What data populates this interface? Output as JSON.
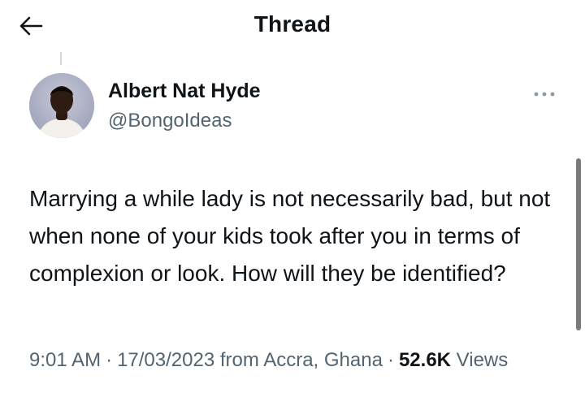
{
  "header": {
    "back_icon": "arrow-left-icon",
    "title": "Thread"
  },
  "author": {
    "name": "Albert Nat Hyde",
    "handle": "@BongoIdeas",
    "more_icon": "more-horizontal-icon"
  },
  "tweet": {
    "text": "Marrying a while lady is not necessarily bad, but not when none of your kids took after you in terms of complexion or look. How will they be identified?"
  },
  "meta": {
    "time": "9:01 AM",
    "separator": "·",
    "date": "17/03/2023",
    "location": "from Accra, Ghana",
    "views_count": "52.6K",
    "views_label": "Views"
  },
  "colors": {
    "text_primary": "#0f1419",
    "text_secondary": "#536471",
    "divider": "#cfd9de"
  }
}
